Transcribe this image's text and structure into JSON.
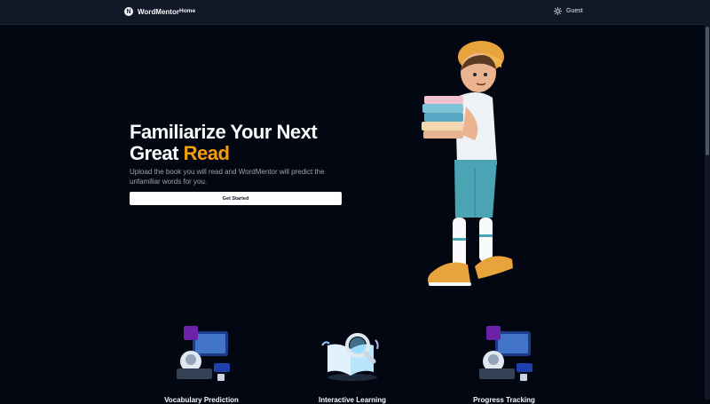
{
  "nav": {
    "brand_name": "WordMentor",
    "logo_letter": "N",
    "home": "Home",
    "user_name": "Guest"
  },
  "hero": {
    "title_main": "Familiarize Your Next Great ",
    "title_accent": "Read",
    "subtitle": "Upload the book you will read and WordMentor will predict the unfamiliar words for you.",
    "cta_label": "Get Started"
  },
  "features": [
    {
      "title": "Vocabulary Prediction"
    },
    {
      "title": "Interactive Learning"
    },
    {
      "title": "Progress Tracking"
    }
  ],
  "colors": {
    "background": "#030712",
    "navbar": "#111827",
    "accent": "#f59e0b",
    "cta_background": "#ffffff"
  }
}
